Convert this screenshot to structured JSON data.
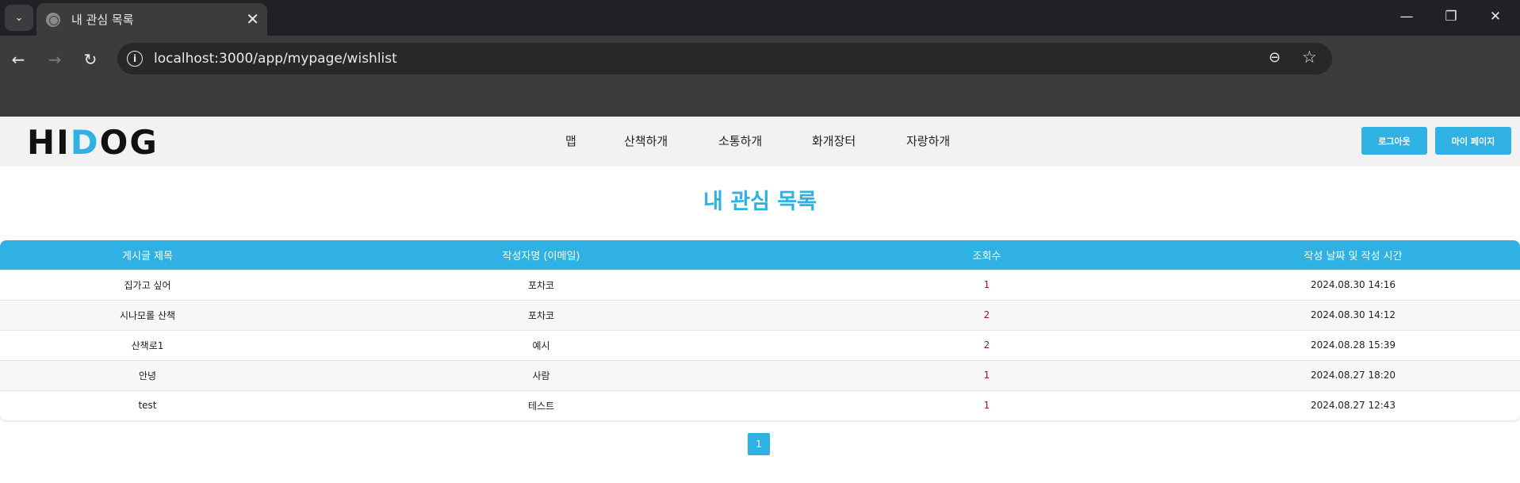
{
  "browser": {
    "tab_title": "내 관심 목록",
    "url": "localhost:3000/app/mypage/wishlist"
  },
  "site": {
    "logo_left": "HI ",
    "logo_dog": "D",
    "logo_right": "OG",
    "nav": [
      "맵",
      "산책하개",
      "소통하개",
      "화개장터",
      "자랑하개"
    ],
    "logout_label": "로그아웃",
    "mypage_label": "마이 페이지"
  },
  "page": {
    "title": "내 관심 목록",
    "columns": [
      "게시글 제목",
      "작성자명 (이메일)",
      "조회수",
      "작성 날짜 및 작성 시간"
    ],
    "rows": [
      {
        "title": "집가고 싶어",
        "author": "포차코",
        "views": "1",
        "date": "2024.08.30 14:16"
      },
      {
        "title": "시나모롤 산책",
        "author": "포차코",
        "views": "2",
        "date": "2024.08.30 14:12"
      },
      {
        "title": "산책로1",
        "author": "예시",
        "views": "2",
        "date": "2024.08.28 15:39"
      },
      {
        "title": "안녕",
        "author": "사람",
        "views": "1",
        "date": "2024.08.27 18:20"
      },
      {
        "title": "test",
        "author": "테스트",
        "views": "1",
        "date": "2024.08.27 12:43"
      }
    ],
    "pagination": [
      "1"
    ]
  },
  "icons": {
    "tab_search": "chevron-down-icon",
    "back": "arrow-left-icon",
    "forward": "arrow-right-icon",
    "reload": "reload-icon",
    "site_info": "info-icon",
    "zoom": "zoom-out-icon",
    "bookmark": "star-icon"
  },
  "colors": {
    "accent": "#2fb2e3",
    "chrome_dark": "#202124",
    "chrome_toolbar": "#3c3c3c"
  }
}
